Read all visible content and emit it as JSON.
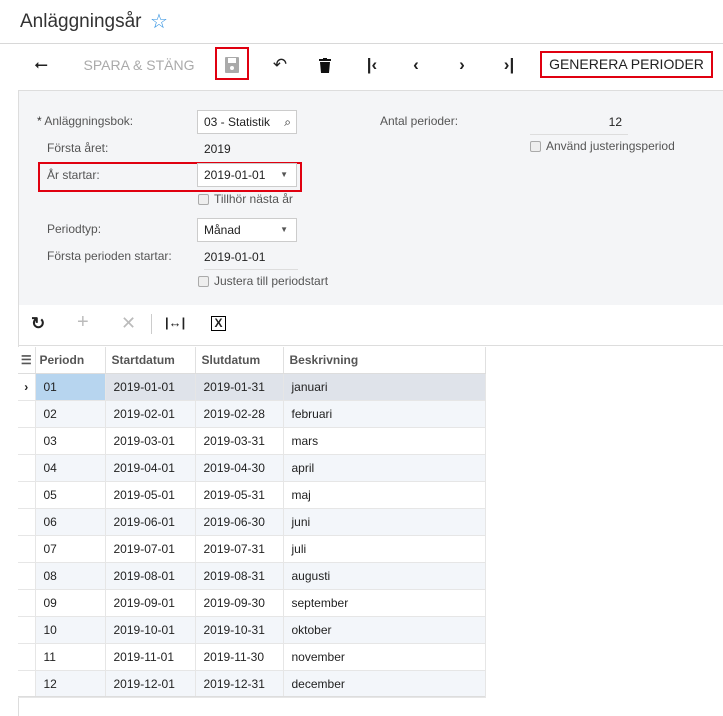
{
  "header": {
    "title": "Anläggningsår",
    "star_icon": "star-outline"
  },
  "toolbar": {
    "back": "⭠",
    "save_close": "SPARA & STÄNG",
    "generate": "GENERERA PERIODER"
  },
  "form": {
    "book_label": "Anläggningsbok:",
    "book_value": "03 - Statistik",
    "first_year_label": "Första året:",
    "first_year_value": "2019",
    "year_starts_label": "År startar:",
    "year_starts_value": "2019-01-01",
    "next_year_label": "Tillhör nästa år",
    "period_type_label": "Periodtyp:",
    "period_type_value": "Månad",
    "first_period_label": "Första perioden startar:",
    "first_period_value": "2019-01-01",
    "adjust_label": "Justera till periodstart",
    "num_periods_label": "Antal perioder:",
    "num_periods_value": "12",
    "use_adjust_label": "Använd justeringsperiod"
  },
  "grid": {
    "columns": [
      "Periodn",
      "Startdatum",
      "Slutdatum",
      "Beskrivning"
    ],
    "rows": [
      [
        "01",
        "2019-01-01",
        "2019-01-31",
        "januari"
      ],
      [
        "02",
        "2019-02-01",
        "2019-02-28",
        "februari"
      ],
      [
        "03",
        "2019-03-01",
        "2019-03-31",
        "mars"
      ],
      [
        "04",
        "2019-04-01",
        "2019-04-30",
        "april"
      ],
      [
        "05",
        "2019-05-01",
        "2019-05-31",
        "maj"
      ],
      [
        "06",
        "2019-06-01",
        "2019-06-30",
        "juni"
      ],
      [
        "07",
        "2019-07-01",
        "2019-07-31",
        "juli"
      ],
      [
        "08",
        "2019-08-01",
        "2019-08-31",
        "augusti"
      ],
      [
        "09",
        "2019-09-01",
        "2019-09-30",
        "september"
      ],
      [
        "10",
        "2019-10-01",
        "2019-10-31",
        "oktober"
      ],
      [
        "11",
        "2019-11-01",
        "2019-11-30",
        "november"
      ],
      [
        "12",
        "2019-12-01",
        "2019-12-31",
        "december"
      ]
    ]
  }
}
